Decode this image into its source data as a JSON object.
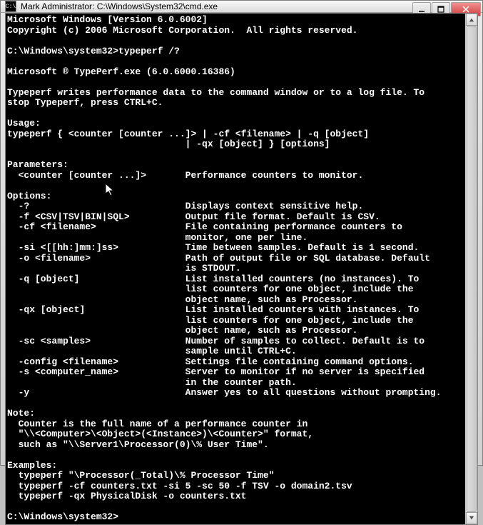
{
  "window": {
    "title": "Mark Administrator: C:\\Windows\\System32\\cmd.exe",
    "icon_label": "C:\\"
  },
  "terminal": {
    "lines": [
      "Microsoft Windows [Version 6.0.6002]",
      "Copyright (c) 2006 Microsoft Corporation.  All rights reserved.",
      "",
      "C:\\Windows\\system32>typeperf /?",
      "",
      "Microsoft ® TypePerf.exe (6.0.6000.16386)",
      "",
      "Typeperf writes performance data to the command window or to a log file. To",
      "stop Typeperf, press CTRL+C.",
      "",
      "Usage:",
      "typeperf { <counter [counter ...]> | -cf <filename> | -q [object]",
      "                                | -qx [object] } [options]",
      "",
      "Parameters:",
      "  <counter [counter ...]>       Performance counters to monitor.",
      "",
      "Options:",
      "  -?                            Displays context sensitive help.",
      "  -f <CSV|TSV|BIN|SQL>          Output file format. Default is CSV.",
      "  -cf <filename>                File containing performance counters to",
      "                                monitor, one per line.",
      "  -si <[[hh:]mm:]ss>            Time between samples. Default is 1 second.",
      "  -o <filename>                 Path of output file or SQL database. Default",
      "                                is STDOUT.",
      "  -q [object]                   List installed counters (no instances). To",
      "                                list counters for one object, include the",
      "                                object name, such as Processor.",
      "  -qx [object]                  List installed counters with instances. To",
      "                                list counters for one object, include the",
      "                                object name, such as Processor.",
      "  -sc <samples>                 Number of samples to collect. Default is to",
      "                                sample until CTRL+C.",
      "  -config <filename>            Settings file containing command options.",
      "  -s <computer_name>            Server to monitor if no server is specified",
      "                                in the counter path.",
      "  -y                            Answer yes to all questions without prompting.",
      "",
      "Note:",
      "  Counter is the full name of a performance counter in",
      "  \"\\\\<Computer>\\<Object>(<Instance>)\\<Counter>\" format,",
      "  such as \"\\\\Server1\\Processor(0)\\% User Time\".",
      "",
      "Examples:",
      "  typeperf \"\\Processor(_Total)\\% Processor Time\"",
      "  typeperf -cf counters.txt -si 5 -sc 50 -f TSV -o domain2.tsv",
      "  typeperf -qx PhysicalDisk -o counters.txt",
      "",
      "C:\\Windows\\system32>"
    ]
  }
}
